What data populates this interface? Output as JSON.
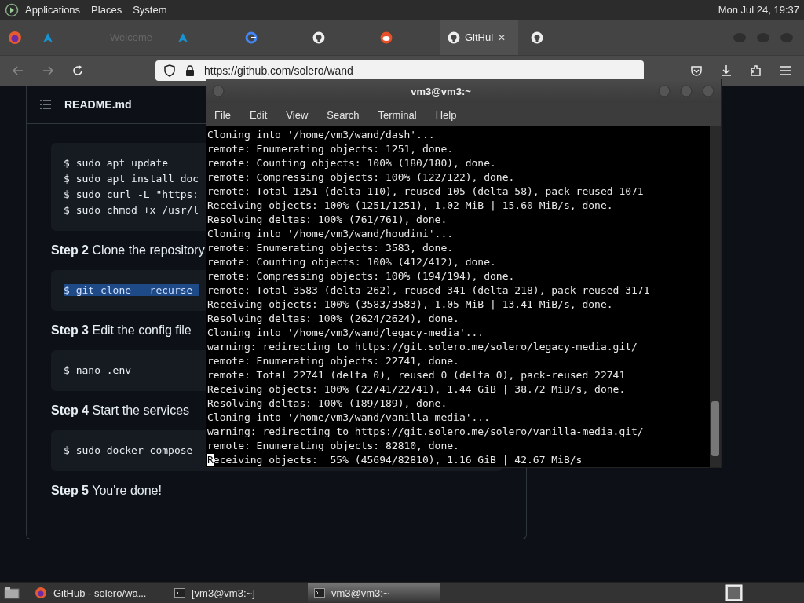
{
  "top_panel": {
    "menus": [
      "Applications",
      "Places",
      "System"
    ],
    "clock": "Mon Jul 24, 19:37"
  },
  "browser": {
    "tabs": [
      {
        "selected": false
      },
      {
        "label": "Welcome",
        "selected": false
      },
      {
        "selected": false
      },
      {
        "selected": false
      },
      {
        "selected": false
      },
      {
        "selected": false
      },
      {
        "label": "GitHul",
        "close": "✕",
        "selected": true
      },
      {
        "selected": false
      }
    ],
    "url": "https://github.com/solero/wand"
  },
  "readme": {
    "title": "README.md",
    "blocks": [
      {
        "kind": "code",
        "lines": [
          "$ sudo apt update",
          "$ sudo apt install doc",
          "$ sudo curl -L \"https:",
          "$ sudo chmod +x /usr/l"
        ],
        "highlighted": false
      },
      {
        "kind": "step",
        "label": "Step 2",
        "text": "Clone the repository"
      },
      {
        "kind": "code",
        "lines": [
          "$ git clone --recurse-"
        ],
        "highlighted": true
      },
      {
        "kind": "step",
        "label": "Step 3",
        "text": "Edit the config file"
      },
      {
        "kind": "code",
        "lines": [
          "$ nano .env"
        ],
        "highlighted": false
      },
      {
        "kind": "step",
        "label": "Step 4",
        "text": "Start the services"
      },
      {
        "kind": "code",
        "lines": [
          "$ sudo docker-compose"
        ],
        "highlighted": false
      },
      {
        "kind": "step",
        "label": "Step 5",
        "text": "You're done!"
      }
    ]
  },
  "terminal": {
    "title": "vm3@vm3:~",
    "menus": [
      "File",
      "Edit",
      "View",
      "Search",
      "Terminal",
      "Help"
    ],
    "lines": [
      {
        "text": "Cloning into '/home/vm3/wand/dash'...",
        "cursor": false
      },
      {
        "text": "remote: Enumerating objects: 1251, done.",
        "cursor": false
      },
      {
        "text": "remote: Counting objects: 100% (180/180), done.",
        "cursor": false
      },
      {
        "text": "remote: Compressing objects: 100% (122/122), done.",
        "cursor": false
      },
      {
        "text": "remote: Total 1251 (delta 110), reused 105 (delta 58), pack-reused 1071",
        "cursor": false
      },
      {
        "text": "Receiving objects: 100% (1251/1251), 1.02 MiB | 15.60 MiB/s, done.",
        "cursor": false
      },
      {
        "text": "Resolving deltas: 100% (761/761), done.",
        "cursor": false
      },
      {
        "text": "Cloning into '/home/vm3/wand/houdini'...",
        "cursor": false
      },
      {
        "text": "remote: Enumerating objects: 3583, done.",
        "cursor": false
      },
      {
        "text": "remote: Counting objects: 100% (412/412), done.",
        "cursor": false
      },
      {
        "text": "remote: Compressing objects: 100% (194/194), done.",
        "cursor": false
      },
      {
        "text": "remote: Total 3583 (delta 262), reused 341 (delta 218), pack-reused 3171",
        "cursor": false
      },
      {
        "text": "Receiving objects: 100% (3583/3583), 1.05 MiB | 13.41 MiB/s, done.",
        "cursor": false
      },
      {
        "text": "Resolving deltas: 100% (2624/2624), done.",
        "cursor": false
      },
      {
        "text": "Cloning into '/home/vm3/wand/legacy-media'...",
        "cursor": false
      },
      {
        "text": "warning: redirecting to https://git.solero.me/solero/legacy-media.git/",
        "cursor": false
      },
      {
        "text": "remote: Enumerating objects: 22741, done.",
        "cursor": false
      },
      {
        "text": "remote: Total 22741 (delta 0), reused 0 (delta 0), pack-reused 22741",
        "cursor": false
      },
      {
        "text": "Receiving objects: 100% (22741/22741), 1.44 GiB | 38.72 MiB/s, done.",
        "cursor": false
      },
      {
        "text": "Resolving deltas: 100% (189/189), done.",
        "cursor": false
      },
      {
        "text": "Cloning into '/home/vm3/wand/vanilla-media'...",
        "cursor": false
      },
      {
        "text": "warning: redirecting to https://git.solero.me/solero/vanilla-media.git/",
        "cursor": false
      },
      {
        "text": "remote: Enumerating objects: 82810, done.",
        "cursor": false
      },
      {
        "text": "Receiving objects:  55% (45694/82810), 1.16 GiB | 42.67 MiB/s",
        "cursor": true
      }
    ]
  },
  "taskbar": {
    "items": [
      {
        "label": "GitHub - solero/wa...",
        "selected": false
      },
      {
        "label": "[vm3@vm3:~]",
        "selected": false
      },
      {
        "label": "vm3@vm3:~",
        "selected": true
      }
    ]
  }
}
